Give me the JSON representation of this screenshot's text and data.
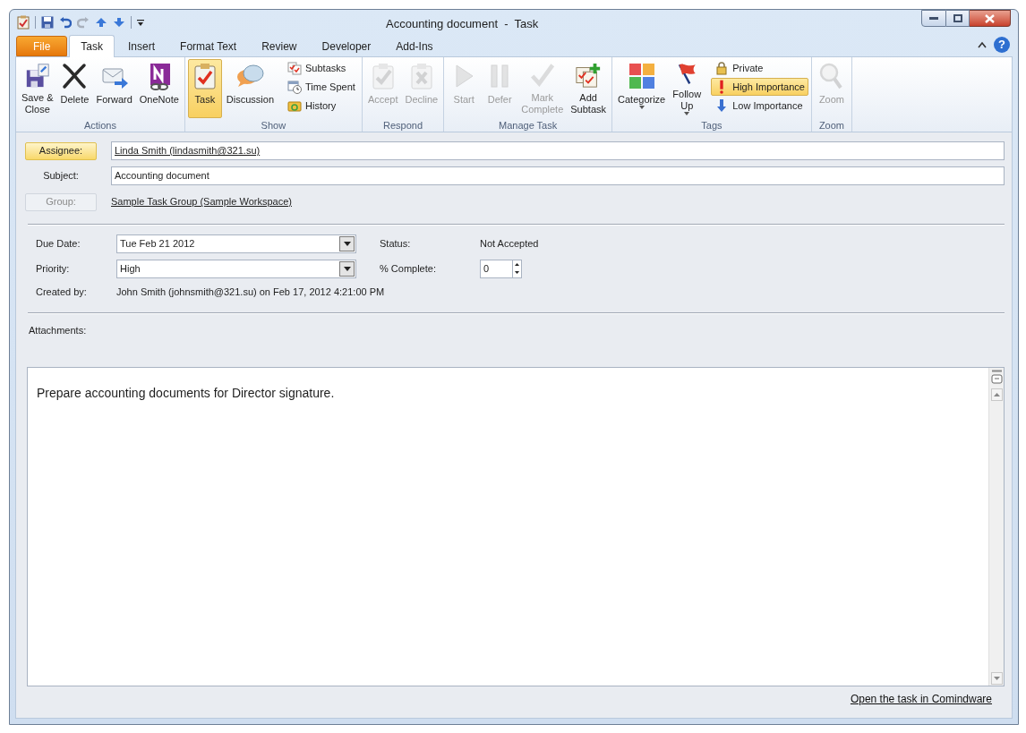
{
  "window": {
    "title": "Accounting document  -  Task"
  },
  "tabs": [
    {
      "label": "File",
      "kind": "file",
      "selected": false
    },
    {
      "label": "Task",
      "kind": "tab",
      "selected": true
    },
    {
      "label": "Insert",
      "kind": "tab",
      "selected": false
    },
    {
      "label": "Format Text",
      "kind": "tab",
      "selected": false
    },
    {
      "label": "Review",
      "kind": "tab",
      "selected": false
    },
    {
      "label": "Developer",
      "kind": "tab",
      "selected": false
    },
    {
      "label": "Add-Ins",
      "kind": "tab",
      "selected": false
    }
  ],
  "ribbon": [
    {
      "label": "Actions",
      "buttons": [
        {
          "label": "Save &\nClose",
          "kind": "large",
          "disabled": false,
          "selected": false,
          "dropdown": false
        },
        {
          "label": "Delete",
          "kind": "large",
          "disabled": false,
          "selected": false,
          "dropdown": false
        },
        {
          "label": "Forward",
          "kind": "large",
          "disabled": false,
          "selected": false,
          "dropdown": false
        },
        {
          "label": "OneNote",
          "kind": "large",
          "disabled": false,
          "selected": false,
          "dropdown": false
        }
      ]
    },
    {
      "label": "Show",
      "buttons": [
        {
          "label": "Task",
          "kind": "large",
          "disabled": false,
          "selected": true,
          "dropdown": false
        },
        {
          "label": "Discussion",
          "kind": "large",
          "disabled": false,
          "selected": false,
          "dropdown": false
        },
        {
          "label": "Subtasks",
          "kind": "small",
          "disabled": false,
          "selected": false
        },
        {
          "label": "Time Spent",
          "kind": "small",
          "disabled": false,
          "selected": false
        },
        {
          "label": "History",
          "kind": "small",
          "disabled": false,
          "selected": false
        }
      ]
    },
    {
      "label": "Respond",
      "buttons": [
        {
          "label": "Accept",
          "kind": "large",
          "disabled": true,
          "selected": false,
          "dropdown": false
        },
        {
          "label": "Decline",
          "kind": "large",
          "disabled": true,
          "selected": false,
          "dropdown": false
        }
      ]
    },
    {
      "label": "Manage Task",
      "buttons": [
        {
          "label": "Start",
          "kind": "large",
          "disabled": true,
          "selected": false,
          "dropdown": false
        },
        {
          "label": "Defer",
          "kind": "large",
          "disabled": true,
          "selected": false,
          "dropdown": false
        },
        {
          "label": "Mark\nComplete",
          "kind": "large",
          "disabled": true,
          "selected": false,
          "dropdown": false
        },
        {
          "label": "Add\nSubtask",
          "kind": "large",
          "disabled": false,
          "selected": false,
          "dropdown": false
        }
      ]
    },
    {
      "label": "Tags",
      "buttons": [
        {
          "label": "Categorize",
          "kind": "large",
          "disabled": false,
          "selected": false,
          "dropdown": true
        },
        {
          "label": "Follow\nUp",
          "kind": "large",
          "disabled": false,
          "selected": false,
          "dropdown": true
        },
        {
          "label": "Private",
          "kind": "small",
          "disabled": false,
          "selected": false
        },
        {
          "label": "High Importance",
          "kind": "small",
          "disabled": false,
          "selected": true
        },
        {
          "label": "Low Importance",
          "kind": "small",
          "disabled": false,
          "selected": false
        }
      ]
    },
    {
      "label": "Zoom",
      "buttons": [
        {
          "label": "Zoom",
          "kind": "large",
          "disabled": true,
          "selected": false,
          "dropdown": false
        }
      ]
    }
  ],
  "header": {
    "assignee": {
      "button": "Assignee:",
      "selected": true,
      "value": "Linda Smith (lindasmith@321.su)"
    },
    "subject": {
      "label": "Subject:",
      "value": "Accounting document"
    },
    "group": {
      "button": "Group:",
      "disabled": true,
      "value": "Sample Task Group (Sample Workspace)"
    }
  },
  "details": {
    "due_date": {
      "label": "Due Date:",
      "value": "Tue Feb 21 2012"
    },
    "status": {
      "label": "Status:",
      "value": "Not Accepted"
    },
    "priority": {
      "label": "Priority:",
      "value": "High"
    },
    "percent_complete": {
      "label": "% Complete:",
      "value": "0"
    },
    "created_by": {
      "label": "Created by:",
      "value": "John Smith (johnsmith@321.su) on Feb 17, 2012 4:21:00 PM"
    }
  },
  "attachments": {
    "label": "Attachments:"
  },
  "body": {
    "text": "Prepare accounting documents for Director signature."
  },
  "footer_link": "Open the task in Comindware",
  "help_button": "?"
}
